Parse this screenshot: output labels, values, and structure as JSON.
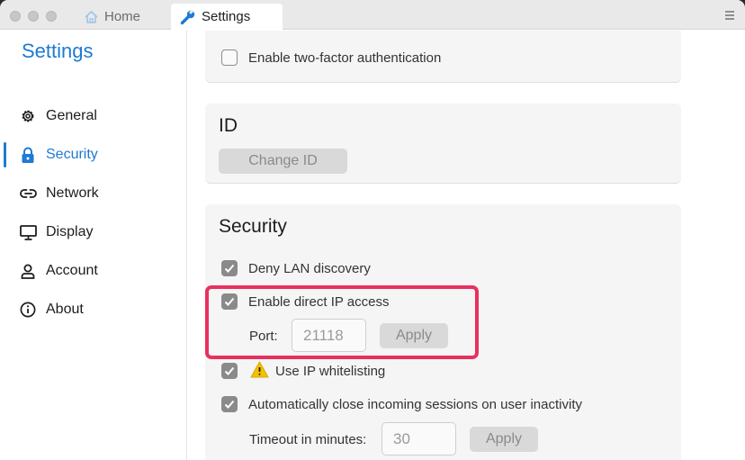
{
  "tabs": [
    {
      "label": "Home",
      "icon": "home-icon"
    },
    {
      "label": "Settings",
      "icon": "wrench-icon"
    }
  ],
  "sidebar": {
    "title": "Settings",
    "active": "Security",
    "items": [
      {
        "label": "General",
        "icon": "gear-icon"
      },
      {
        "label": "Security",
        "icon": "lock-icon"
      },
      {
        "label": "Network",
        "icon": "link-icon"
      },
      {
        "label": "Display",
        "icon": "monitor-icon"
      },
      {
        "label": "Account",
        "icon": "person-icon"
      },
      {
        "label": "About",
        "icon": "info-icon"
      }
    ]
  },
  "twofa": {
    "label": "Enable two-factor authentication",
    "checked": false
  },
  "id_section": {
    "title": "ID",
    "change_label": "Change ID"
  },
  "security": {
    "title": "Security",
    "deny_lan": {
      "label": "Deny LAN discovery",
      "checked": true
    },
    "direct_ip": {
      "label": "Enable direct IP access",
      "checked": true,
      "port_label": "Port:",
      "port_value": "21118",
      "apply_label": "Apply"
    },
    "whitelist": {
      "label": "Use IP whitelisting",
      "checked": true,
      "icon": "warning-icon"
    },
    "auto_close": {
      "label": "Automatically close incoming sessions on user inactivity",
      "checked": true,
      "timeout_label": "Timeout in minutes:",
      "timeout_value": "30",
      "apply_label": "Apply"
    }
  },
  "colors": {
    "accent": "#1e7ad2",
    "highlight": "#e8315e",
    "warning": "#f2c200"
  }
}
